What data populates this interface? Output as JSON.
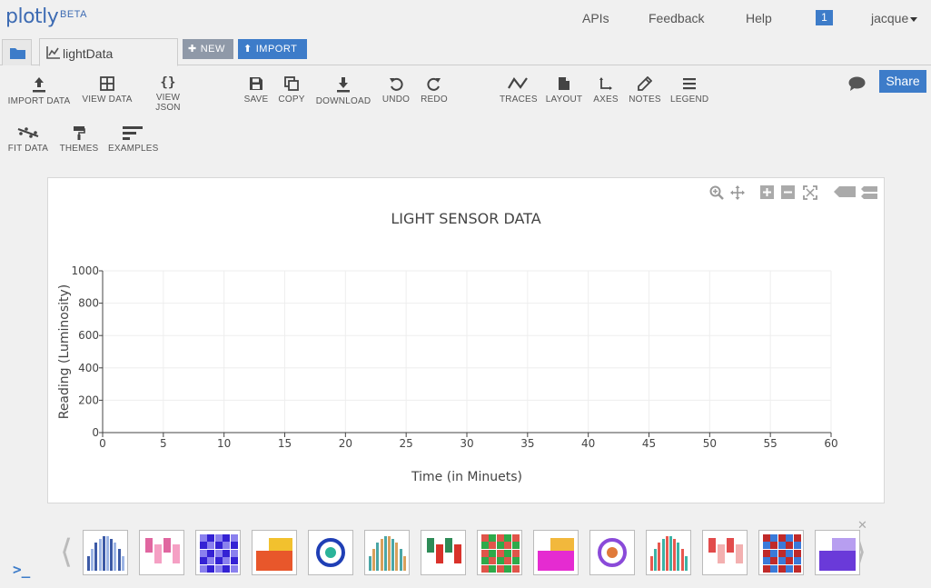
{
  "app": {
    "logo": "plotly",
    "beta": "BETA"
  },
  "topnav": {
    "links": [
      "APIs",
      "Feedback",
      "Help"
    ],
    "notification_count": "1",
    "user": "jacque"
  },
  "tabs": {
    "file_tab": "lightData",
    "new_label": "NEW",
    "import_label": "IMPORT"
  },
  "toolbar": {
    "row1": [
      {
        "label": "IMPORT DATA",
        "icon": "upload-icon"
      },
      {
        "label": "VIEW DATA",
        "icon": "grid-icon"
      },
      {
        "label": "VIEW JSON",
        "icon": "braces-icon"
      },
      {
        "label": "SAVE",
        "icon": "save-icon"
      },
      {
        "label": "COPY",
        "icon": "copy-icon"
      },
      {
        "label": "DOWNLOAD",
        "icon": "download-icon"
      },
      {
        "label": "UNDO",
        "icon": "undo-icon"
      },
      {
        "label": "REDO",
        "icon": "redo-icon"
      },
      {
        "label": "TRACES",
        "icon": "traces-icon"
      },
      {
        "label": "LAYOUT",
        "icon": "layout-icon"
      },
      {
        "label": "AXES",
        "icon": "axes-icon"
      },
      {
        "label": "NOTES",
        "icon": "pencil-icon"
      },
      {
        "label": "LEGEND",
        "icon": "legend-icon"
      }
    ],
    "row2": [
      {
        "label": "FIT DATA",
        "icon": "fit-data-icon"
      },
      {
        "label": "THEMES",
        "icon": "paint-roller-icon"
      },
      {
        "label": "EXAMPLES",
        "icon": "examples-icon"
      }
    ],
    "share_label": "Share"
  },
  "chart_data": {
    "type": "line",
    "title": "LIGHT SENSOR DATA",
    "xlabel": "Time (in Minuets)",
    "ylabel": "Reading (Luminosity)",
    "xlim": [
      0,
      60
    ],
    "ylim": [
      0,
      1000
    ],
    "x_ticks": [
      0,
      5,
      10,
      15,
      20,
      25,
      30,
      35,
      40,
      45,
      50,
      55,
      60
    ],
    "y_ticks": [
      0,
      200,
      400,
      600,
      800,
      1000
    ],
    "grid": true,
    "series": []
  },
  "thumbnails": [
    {
      "name": "thumb-bell-bars",
      "colors": [
        "#3c5aa6",
        "#9db5e5"
      ]
    },
    {
      "name": "thumb-box-plot",
      "colors": [
        "#e066a0",
        "#f5a0c4"
      ]
    },
    {
      "name": "thumb-bar-annotated",
      "colors": [
        "#3422d4",
        "#8a80ee"
      ]
    },
    {
      "name": "thumb-heatmap",
      "colors": [
        "#e8572b",
        "#f2c12e"
      ]
    },
    {
      "name": "thumb-area",
      "colors": [
        "#1f3fb5",
        "#2bb39a"
      ]
    },
    {
      "name": "thumb-polar-lines",
      "colors": [
        "#4aa6a6",
        "#d9a05b"
      ]
    },
    {
      "name": "thumb-wind-rose",
      "colors": [
        "#2e8b57",
        "#d9322b"
      ]
    },
    {
      "name": "thumb-contour-lines",
      "colors": [
        "#2eaa4a",
        "#e0554a"
      ]
    },
    {
      "name": "thumb-histogram",
      "colors": [
        "#e52bd1",
        "#f2b83c"
      ]
    },
    {
      "name": "thumb-box-line",
      "colors": [
        "#8a4ad9",
        "#e07a3a"
      ]
    },
    {
      "name": "thumb-error-bars",
      "colors": [
        "#e8584f",
        "#3cb3a5"
      ]
    },
    {
      "name": "thumb-bubbles",
      "colors": [
        "#e24b4b",
        "#f3b0b0"
      ]
    },
    {
      "name": "thumb-matrix",
      "colors": [
        "#3a7ad9",
        "#c02a2a"
      ]
    },
    {
      "name": "thumb-network",
      "colors": [
        "#6a3ad9",
        "#b79ef0"
      ]
    }
  ],
  "console_prompt": ">_"
}
